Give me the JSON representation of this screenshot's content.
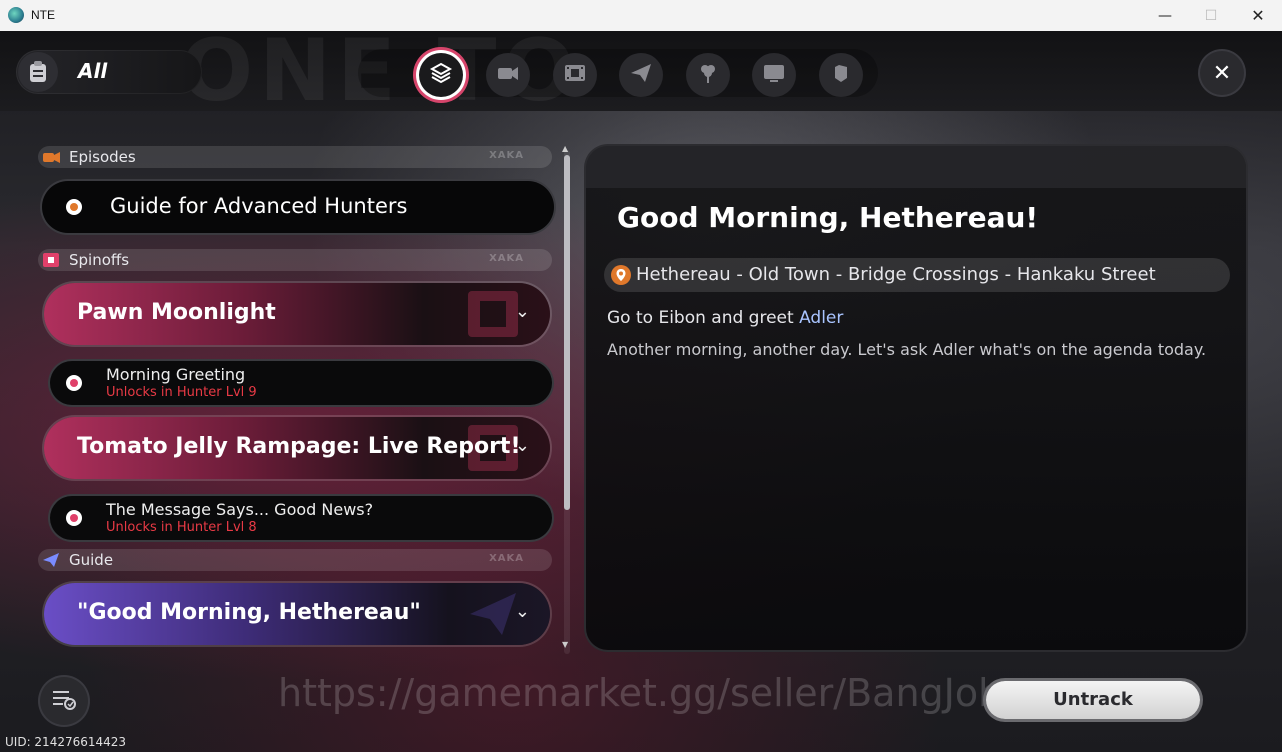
{
  "window": {
    "title": "NTE",
    "minimize": "—",
    "maximize": "☐",
    "close": "✕"
  },
  "header": {
    "filter_label": "All",
    "close_label": "✕",
    "background_text": "ONE TO",
    "categories": [
      {
        "name": "all-quests",
        "active": true
      },
      {
        "name": "episodes",
        "active": false
      },
      {
        "name": "spinoffs",
        "active": false
      },
      {
        "name": "guide",
        "active": false
      },
      {
        "name": "side",
        "active": false
      },
      {
        "name": "events",
        "active": false
      },
      {
        "name": "misc",
        "active": false
      }
    ]
  },
  "sections": {
    "episodes": {
      "name": "Episodes",
      "tag": "XAKA"
    },
    "spinoffs": {
      "name": "Spinoffs",
      "tag": "XAKA"
    },
    "guide": {
      "name": "Guide",
      "tag": "XAKA"
    }
  },
  "quests": {
    "advanced_hunters": "Guide for Advanced Hunters",
    "pawn_moonlight": "Pawn Moonlight",
    "morning_greeting": {
      "title": "Morning Greeting",
      "lock": "Unlocks in Hunter Lvl 9"
    },
    "tomato_jelly": "Tomato Jelly Rampage: Live Report!",
    "message_says": {
      "title": "The Message Says... Good News?",
      "lock": "Unlocks in Hunter Lvl 8"
    },
    "good_morning": "\"Good Morning, Hethereau\""
  },
  "detail": {
    "title": "Good Morning, Hethereau!",
    "location": "Hethereau - Old Town - Bridge Crossings - Hankaku Street",
    "objective_prefix": "Go to Eibon and greet ",
    "objective_target": "Adler",
    "description": "Another morning, another day. Let's ask Adler what's on the agenda today."
  },
  "footer": {
    "watermark": "https://gamemarket.gg/seller/BangJoh",
    "untrack_label": "Untrack",
    "uid": "UID: 214276614423"
  },
  "colors": {
    "accent_pink": "#d6456b",
    "quest_orange": "#e0782b",
    "lock_red": "#e83a45",
    "link_blue": "#a9c4ff"
  }
}
